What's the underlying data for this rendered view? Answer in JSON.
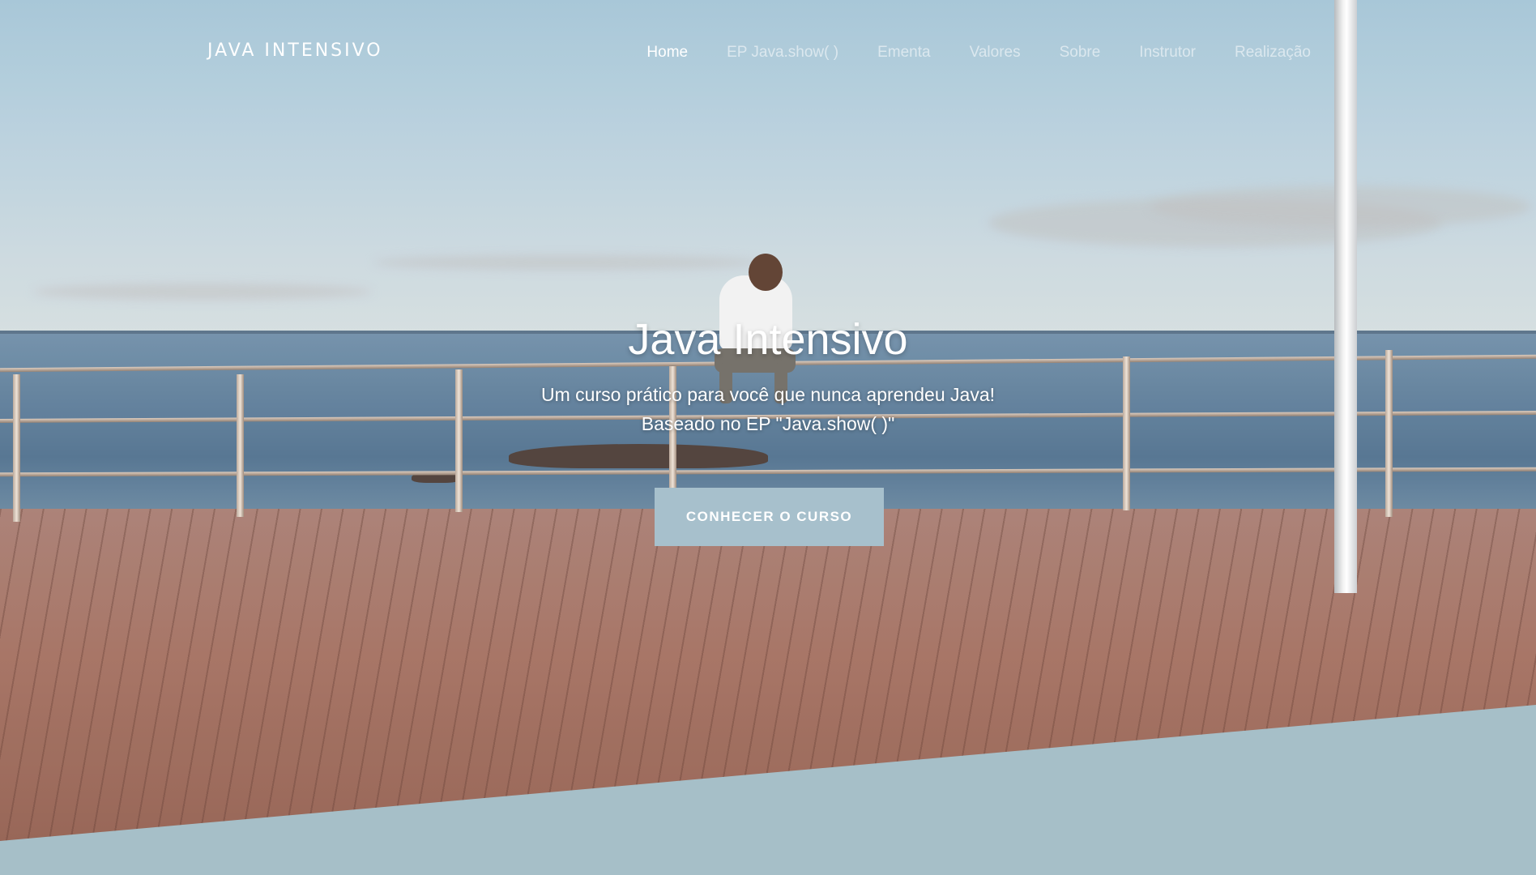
{
  "brand": "JAVA INTENSIVO",
  "nav": {
    "items": [
      {
        "label": "Home",
        "active": true
      },
      {
        "label": "EP Java.show( )",
        "active": false
      },
      {
        "label": "Ementa",
        "active": false
      },
      {
        "label": "Valores",
        "active": false
      },
      {
        "label": "Sobre",
        "active": false
      },
      {
        "label": "Instrutor",
        "active": false
      },
      {
        "label": "Realização",
        "active": false
      }
    ]
  },
  "hero": {
    "title": "Java Intensivo",
    "subtitle_line1": "Um curso prático para você que nunca aprendeu Java!",
    "subtitle_line2": "Baseado no EP \"Java.show( )\"",
    "cta_label": "CONHECER O CURSO"
  },
  "colors": {
    "accent": "#a7c0cc",
    "band": "#a6bfc8",
    "text": "#ffffff"
  }
}
